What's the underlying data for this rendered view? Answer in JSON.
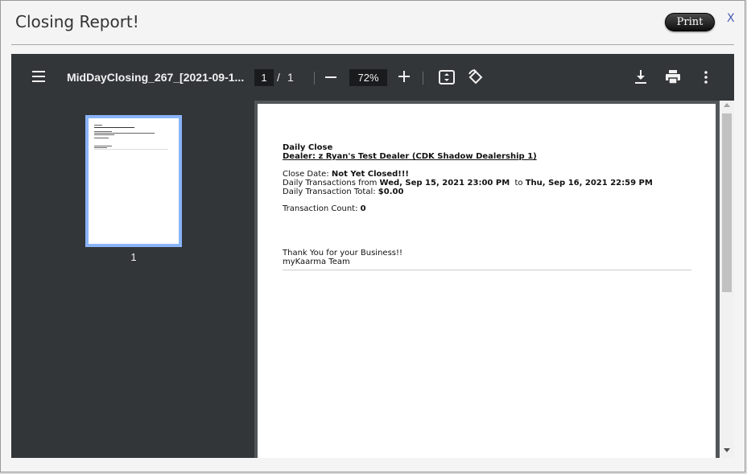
{
  "dialog": {
    "title": "Closing Report!",
    "print_label": "Print",
    "close_label": "X"
  },
  "viewer": {
    "doc_title": "MidDayClosing_267_[2021-09-1...",
    "current_page": "1",
    "page_separator": "/",
    "total_pages": "1",
    "zoom": "72%",
    "thumbnail_label": "1",
    "icons": [
      "menu-icon",
      "zoom-out-icon",
      "zoom-in-icon",
      "fit-page-icon",
      "rotate-icon",
      "download-icon",
      "print-icon",
      "more-options-icon"
    ]
  },
  "report": {
    "heading": "Daily Close",
    "dealer": "Dealer: z Ryan's Test Dealer (CDK Shadow Dealership 1)",
    "close_date_label": "Close Date: ",
    "close_date_value": "Not Yet Closed!!!",
    "transactions_from_label": "Daily Transactions from ",
    "transactions_from_value": "Wed, Sep 15, 2021 23:00 PM",
    "to_label": "to ",
    "transactions_to_value": "Thu, Sep 16, 2021 22:59 PM",
    "total_label": "Daily Transaction Total: ",
    "total_value": "$0.00",
    "count_label": "Transaction Count: ",
    "count_value": "0",
    "thanks": "Thank You for your Business!!",
    "team": "myKaarma Team"
  },
  "colors": {
    "toolbar_bg": "#323639",
    "viewer_bg": "#525659",
    "thumbnail_border": "#8ab4f8",
    "close_link": "#4b5bb5"
  }
}
